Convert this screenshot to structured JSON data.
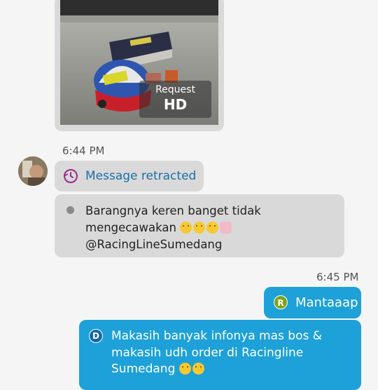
{
  "image_message": {
    "request_label": "Request",
    "quality_label": "HD"
  },
  "timestamps": {
    "first": "6:44 PM",
    "second": "6:45 PM"
  },
  "retracted": {
    "text": "Message retracted",
    "icon": "clock-history-icon"
  },
  "incoming_message": {
    "line1": "Barangnya keren banget tidak",
    "line2": "mengecawakan",
    "line2_emojis": [
      "grin-emoji",
      "smirk-emoji",
      "rock-hand-emoji",
      "thumbs-up-emoji"
    ],
    "line3": "@RacingLineSumedang"
  },
  "outgoing_short": {
    "badge": "R",
    "text": "Mantaaap"
  },
  "outgoing_long": {
    "badge": "D",
    "line1": "Makasih banyak infonya mas bos  &",
    "line2": "makasih udh order di Racingline",
    "line3": "Sumedang",
    "line3_emojis": [
      "smile-emoji",
      "smile-emoji"
    ]
  },
  "colors": {
    "outgoing_bubble": "#1da1d8",
    "incoming_bubble": "#d9d9d9",
    "link_blue": "#1a6fa5",
    "retract_icon": "#9b2b8a"
  }
}
